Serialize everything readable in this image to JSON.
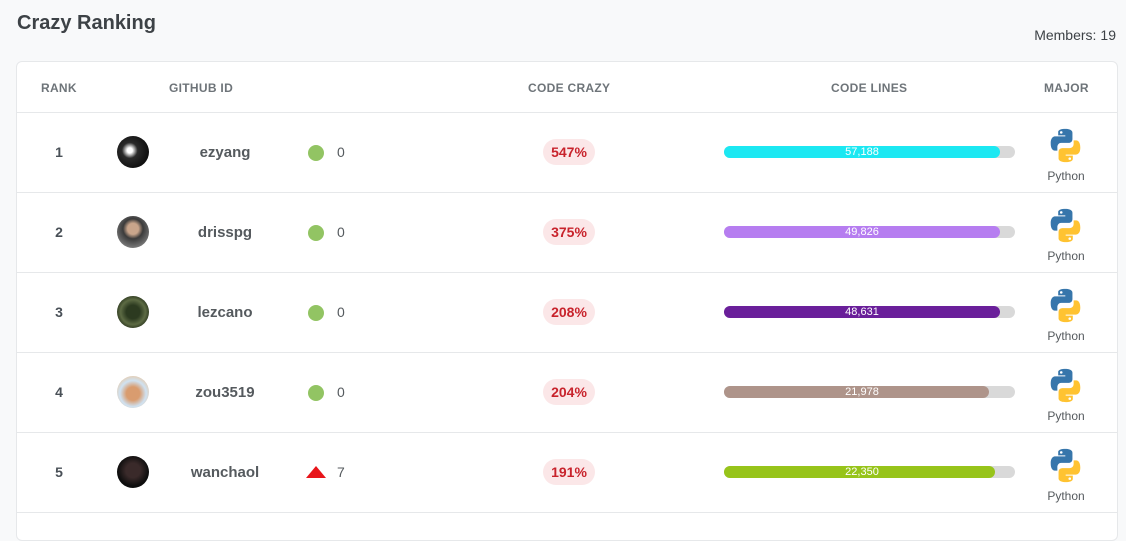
{
  "page": {
    "title": "Crazy Ranking",
    "members_label": "Members:",
    "members_count": "19"
  },
  "table": {
    "headers": {
      "rank": "RANK",
      "github_id": "GITHUB ID",
      "code_crazy": "CODE CRAZY",
      "code_lines": "CODE LINES",
      "major": "MAJOR"
    },
    "rows": [
      {
        "rank": "1",
        "username": "ezyang",
        "change_icon": "neutral-dot-icon",
        "change": "0",
        "crazy": "547%",
        "lines": "57,188",
        "lines_fraction": 0.95,
        "bar_color": "#1ce8f2",
        "major": "Python",
        "major_icon": "python-icon"
      },
      {
        "rank": "2",
        "username": "drisspg",
        "change_icon": "neutral-dot-icon",
        "change": "0",
        "crazy": "375%",
        "lines": "49,826",
        "lines_fraction": 0.95,
        "bar_color": "#b67df0",
        "major": "Python",
        "major_icon": "python-icon"
      },
      {
        "rank": "3",
        "username": "lezcano",
        "change_icon": "neutral-dot-icon",
        "change": "0",
        "crazy": "208%",
        "lines": "48,631",
        "lines_fraction": 0.95,
        "bar_color": "#6a1f9a",
        "major": "Python",
        "major_icon": "python-icon"
      },
      {
        "rank": "4",
        "username": "zou3519",
        "change_icon": "neutral-dot-icon",
        "change": "0",
        "crazy": "204%",
        "lines": "21,978",
        "lines_fraction": 0.91,
        "bar_color": "#ae948a",
        "major": "Python",
        "major_icon": "python-icon"
      },
      {
        "rank": "5",
        "username": "wanchaol",
        "change_icon": "up-arrow-icon",
        "change": "7",
        "crazy": "191%",
        "lines": "22,350",
        "lines_fraction": 0.93,
        "bar_color": "#97c41a",
        "major": "Python",
        "major_icon": "python-icon"
      }
    ]
  },
  "colors": {
    "neutral_dot": "#92c463",
    "up_arrow": "#e8151a",
    "crazy_badge_bg": "#fbe7e8",
    "crazy_badge_text": "#c8232c"
  }
}
